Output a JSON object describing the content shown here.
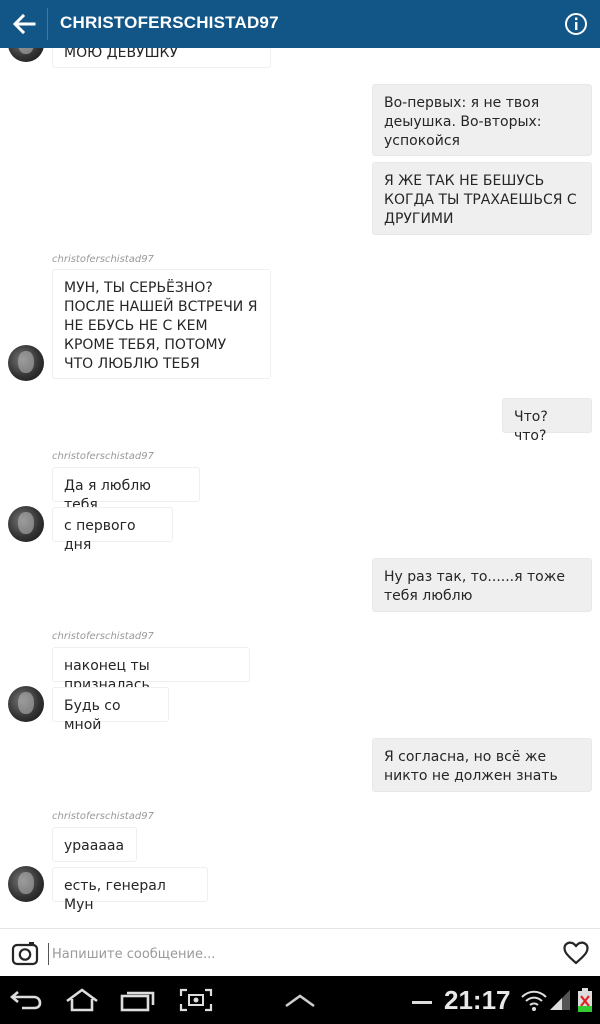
{
  "header": {
    "title": "CHRISTOFERSCHISTAD97"
  },
  "messages": {
    "m0": "МОЮ ДЕВУШКУ",
    "m1": "Во-первых: я не твоя деыушка. Во-вторых: успокойся",
    "m2": "Я ЖЕ ТАК НЕ БЕШУСЬ КОГДА ТЫ ТРАХАЕШЬСЯ С ДРУГИМИ",
    "m3": "МУН, ТЫ СЕРЬЁЗНО? ПОСЛЕ НАШЕЙ ВСТРЕЧИ Я НЕ ЕБУСЬ НЕ С КЕМ КРОМЕ ТЕБЯ, ПОТОМУ ЧТО ЛЮБЛЮ ТЕБЯ",
    "m4": "Что?что?",
    "m5": "Да я люблю тебя",
    "m6": "с первого дня",
    "m7": "Ну раз так, то......я тоже тебя люблю",
    "m8": "наконец ты призналась",
    "m9": "Будь со мной",
    "m10": "Я согласна, но всё же никто не должен знать",
    "m11": "ураааaa",
    "m12": "есть, генерал Мун"
  },
  "sender_name": "christoferschistad97",
  "composer": {
    "placeholder": "Напишите сообщение..."
  },
  "statusbar": {
    "time": "21:17"
  },
  "colors": {
    "header_bg": "#125688",
    "outgoing_bubble": "#efefef",
    "incoming_border": "#efefef",
    "navbar_bg": "#000000"
  },
  "icons": [
    "back-arrow-icon",
    "info-icon",
    "camera-icon",
    "heart-icon",
    "nav-back-icon",
    "nav-home-icon",
    "nav-recent-icon",
    "screenshot-icon",
    "nav-up-icon",
    "wifi-icon",
    "signal-icon",
    "battery-icon"
  ]
}
